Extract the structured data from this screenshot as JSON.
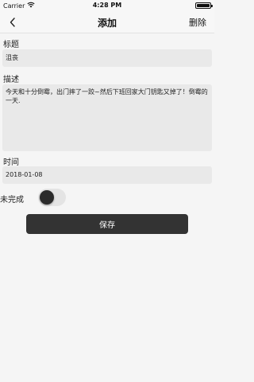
{
  "status_bar": {
    "carrier": "Carrier",
    "time": "4:28 PM"
  },
  "nav": {
    "title": "添加",
    "delete_label": "删除",
    "back_icon": "chevron-left-icon"
  },
  "form": {
    "title_label": "标题",
    "title_value": "沮丧",
    "description_label": "描述",
    "description_value": "今天和十分倒霉，出门摔了一跤~然后下班回家大门钥匙又掉了！倒霉的一天.",
    "time_label": "时间",
    "time_value": "2018-01-08",
    "status_label": "未完成",
    "completed_toggle": false,
    "save_label": "保存"
  },
  "colors": {
    "accent": "#333333",
    "field_bg": "#e9e9e9",
    "page_bg": "#f5f5f5"
  }
}
